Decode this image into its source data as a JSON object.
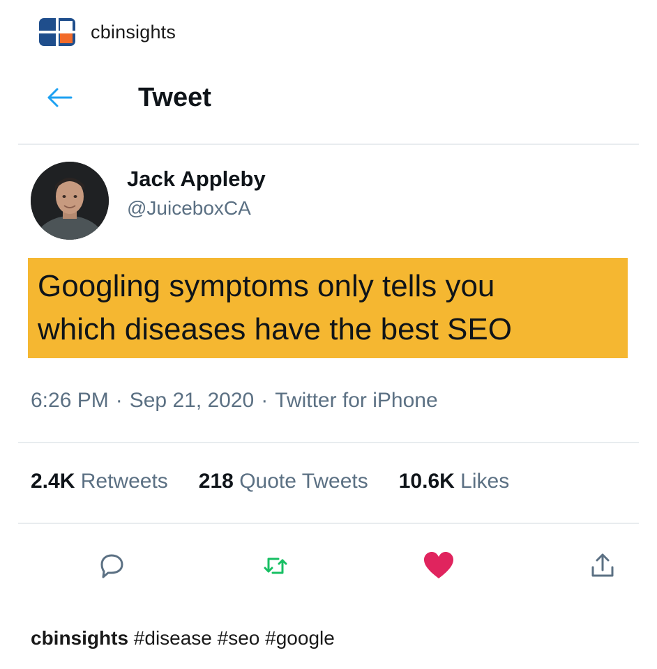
{
  "header": {
    "account_name": "cbinsights",
    "logo_icon": "cbinsights-logo-icon",
    "colors": {
      "logo_blue": "#1f4e8c",
      "logo_orange": "#f26b2a"
    }
  },
  "nav": {
    "back_icon": "arrow-left-icon",
    "title": "Tweet",
    "accent": "#1da1f2"
  },
  "tweet": {
    "author_name": "Jack Appleby",
    "author_handle": "@JuiceboxCA",
    "text_line_1": "Googling symptoms only tells you",
    "text_line_2": "which diseases have the best SEO",
    "highlight_color": "#f5b731",
    "time": "6:26 PM",
    "separator": "·",
    "date": "Sep 21, 2020",
    "source": "Twitter for iPhone"
  },
  "stats": {
    "retweets_count": "2.4K",
    "retweets_label": "Retweets",
    "quotes_count": "218",
    "quotes_label": "Quote Tweets",
    "likes_count": "10.6K",
    "likes_label": "Likes"
  },
  "actions": {
    "reply_icon": "reply-icon",
    "retweet_icon": "retweet-icon",
    "like_icon": "heart-icon",
    "share_icon": "share-icon",
    "colors": {
      "retweet": "#17bf63",
      "like": "#e0245e",
      "neutral": "#5b7083"
    }
  },
  "caption": {
    "account": "cbinsights",
    "hashtags": "#disease #seo #google"
  }
}
